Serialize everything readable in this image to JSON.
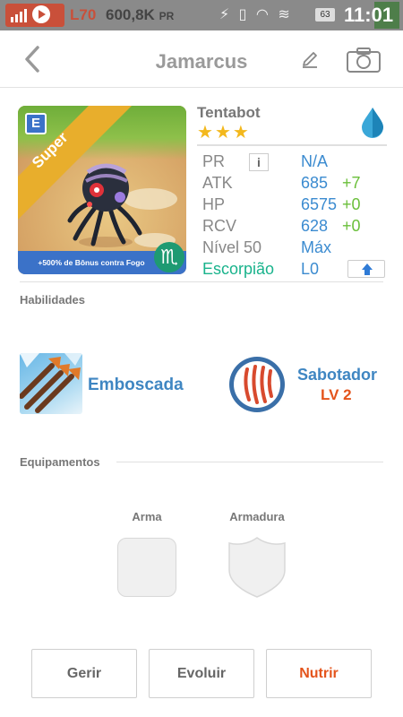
{
  "status_bar": {
    "level": "L70",
    "pr_value": "600,8K",
    "pr_unit": "PR",
    "battery": "63",
    "time": "11:01"
  },
  "header": {
    "title": "Jamarcus"
  },
  "monster_card": {
    "rarity": "Super",
    "grade_letter": "E",
    "bonus_text": "+500% de Bônus contra Fogo",
    "sign_glyph": "♏"
  },
  "monster": {
    "name": "Tentabot",
    "stars": 3,
    "element_icon": "water-drop-icon",
    "stats": {
      "pr": {
        "label": "PR",
        "value": "N/A"
      },
      "atk": {
        "label": "ATK",
        "value": "685",
        "bonus": "+7"
      },
      "hp": {
        "label": "HP",
        "value": "6575",
        "bonus": "+0"
      },
      "rcv": {
        "label": "RCV",
        "value": "628",
        "bonus": "+0"
      },
      "level": {
        "label": "Nível 50",
        "value": "Máx"
      },
      "zodiac": {
        "label": "Escorpião",
        "value": "L0"
      }
    }
  },
  "skills": {
    "heading": "Habilidades",
    "items": [
      {
        "name": "Emboscada"
      },
      {
        "name": "Sabotador",
        "level": "LV 2"
      }
    ]
  },
  "equipment": {
    "heading": "Equipamentos",
    "weapon_label": "Arma",
    "armor_label": "Armadura"
  },
  "actions": {
    "manage": "Gerir",
    "evolve": "Evoluir",
    "feed": "Nutrir"
  },
  "colors": {
    "accent_blue": "#3f86c2",
    "orange": "#e4541c",
    "green": "#6abf3a",
    "teal": "#19b38c"
  }
}
